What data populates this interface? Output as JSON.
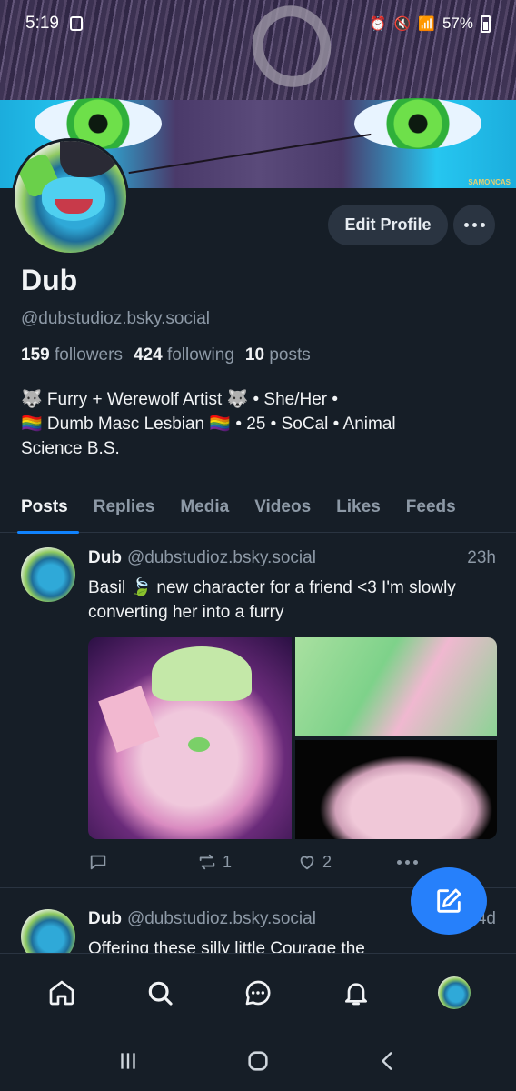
{
  "status_bar": {
    "time": "5:19",
    "battery": "57%"
  },
  "profile": {
    "name": "Dub",
    "handle": "@dubstudioz.bsky.social",
    "followers_count": "159",
    "followers_label": "followers",
    "following_count": "424",
    "following_label": "following",
    "posts_count": "10",
    "posts_label": "posts",
    "bio_line1": "🐺 Furry + Werewolf Artist 🐺 • She/Her •",
    "bio_line2": "🏳️‍🌈 Dumb Masc Lesbian 🏳️‍🌈 • 25 • SoCal • Animal",
    "bio_line3": "Science B.S.",
    "edit_label": "Edit Profile"
  },
  "tabs": [
    {
      "label": "Posts",
      "active": true
    },
    {
      "label": "Replies"
    },
    {
      "label": "Media"
    },
    {
      "label": "Videos"
    },
    {
      "label": "Likes"
    },
    {
      "label": "Feeds"
    }
  ],
  "posts": [
    {
      "author": "Dub",
      "handle": "@dubstudioz.bsky.social",
      "time": "23h",
      "text": "Basil 🍃 new character for a friend <3 I'm slowly converting her into a furry",
      "reply_count": "",
      "repost_count": "1",
      "like_count": "2"
    },
    {
      "author": "Dub",
      "handle": "@dubstudioz.bsky.social",
      "time": "4d",
      "text": "Offering these silly little Courage the"
    }
  ],
  "banner_signature": "SAMONCAS",
  "icons": {
    "nav": [
      "home-icon",
      "search-icon",
      "chat-icon",
      "bell-icon",
      "avatar"
    ],
    "compose": "pencil-square-icon"
  },
  "colors": {
    "background": "#161e27",
    "accent": "#1083fe",
    "fab": "#2680fb",
    "muted_text": "#8d99a6"
  }
}
